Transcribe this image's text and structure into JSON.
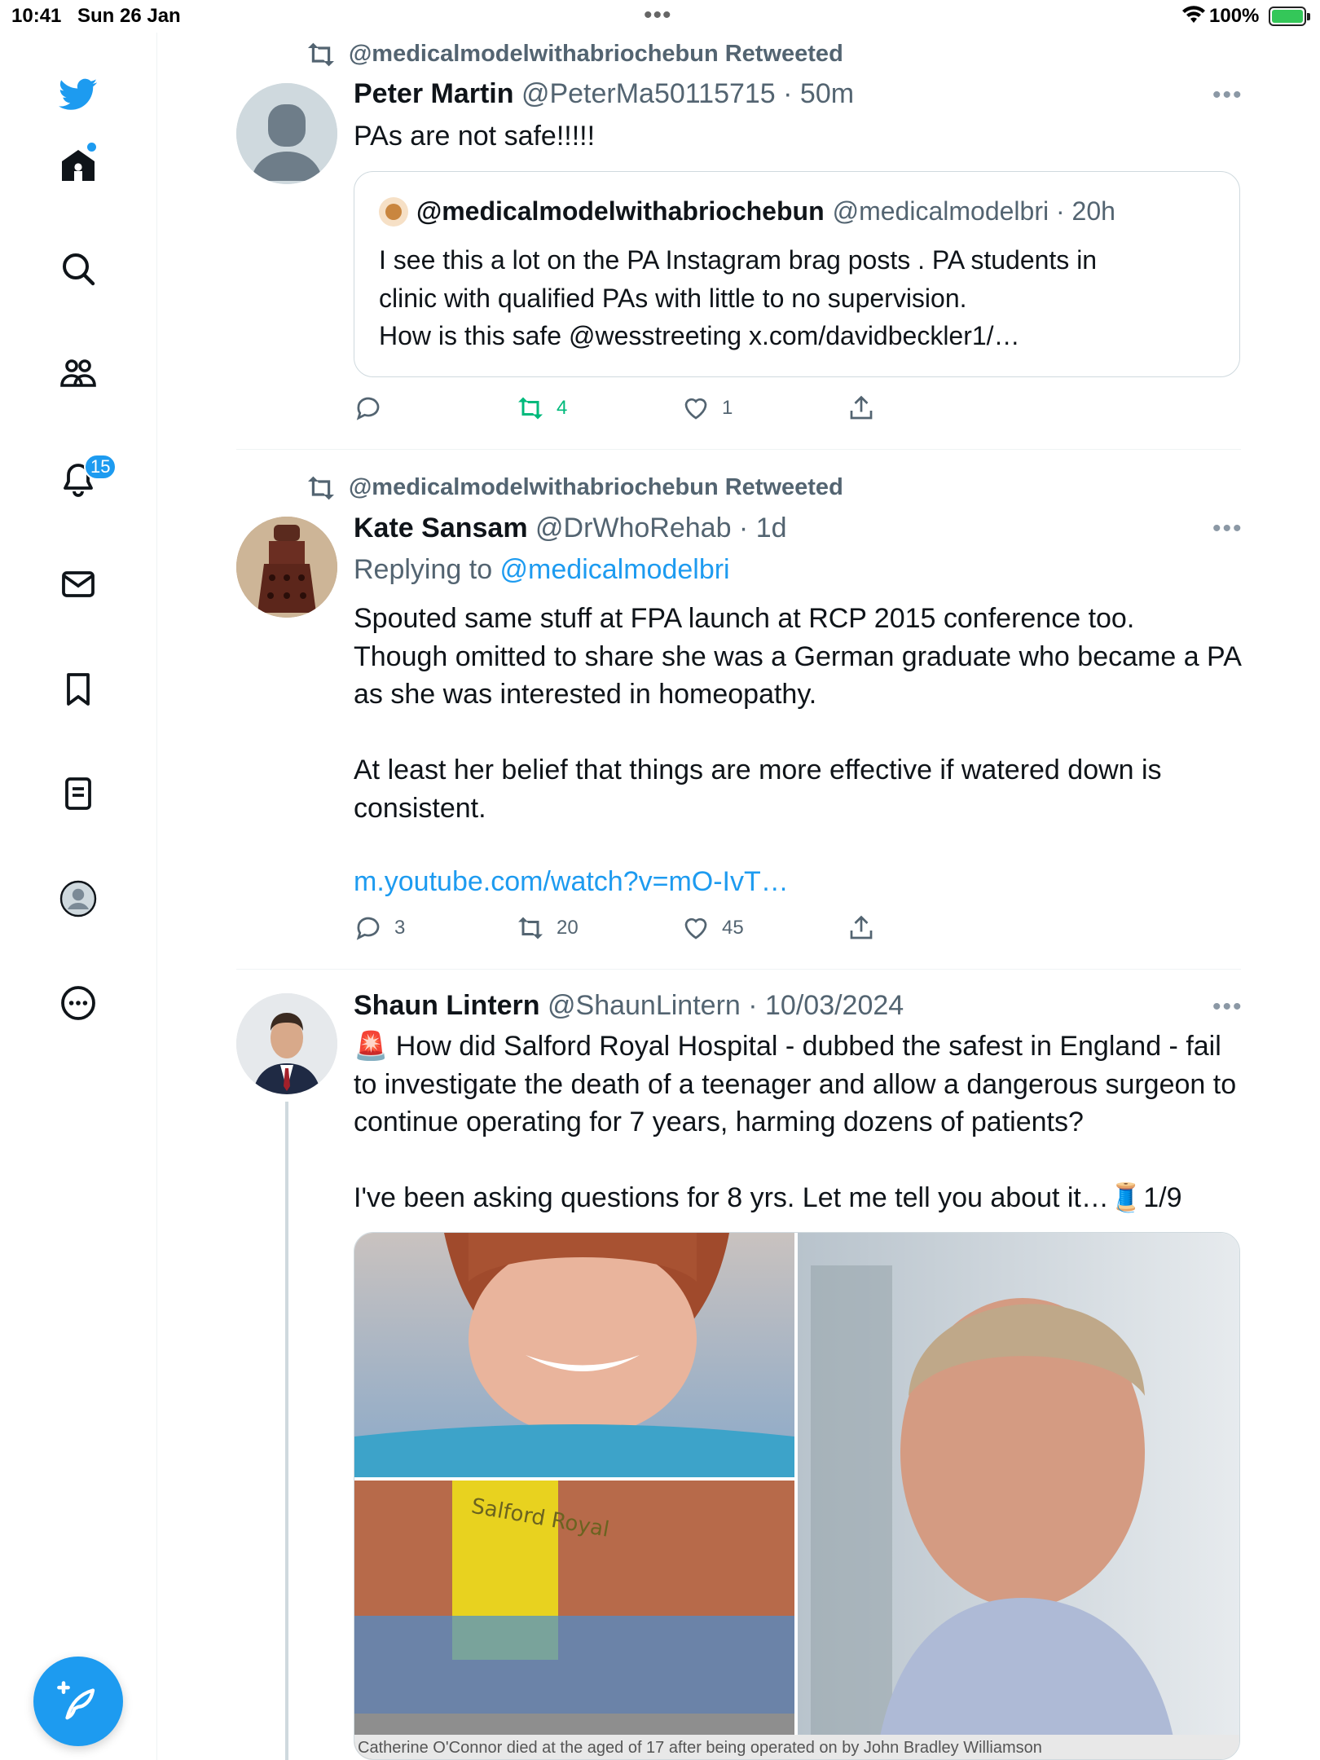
{
  "status_bar": {
    "time": "10:41",
    "date": "Sun 26 Jan",
    "battery": "100%"
  },
  "sidebar": {
    "items": [
      {
        "name": "twitter-logo-icon"
      },
      {
        "name": "home-icon"
      },
      {
        "name": "search-icon"
      },
      {
        "name": "communities-icon"
      },
      {
        "name": "notifications-icon"
      },
      {
        "name": "messages-icon"
      },
      {
        "name": "bookmarks-icon"
      },
      {
        "name": "lists-icon"
      },
      {
        "name": "profile-icon"
      },
      {
        "name": "more-icon"
      }
    ],
    "notifications_badge": "15"
  },
  "tweets": [
    {
      "retweeted_by": "@medicalmodelwithabriochebun Retweeted",
      "name": "Peter Martin",
      "meta": "@PeterMa50115715 · 50m",
      "text": "PAs are not safe!!!!!",
      "quote": {
        "name": "@medicalmodelwithabriochebun",
        "meta": "@medicalmodelbri · 20h",
        "text": "I see this a lot on the PA Instagram brag posts . PA students in\nclinic with qualified PAs with little to no supervision.\nHow is this safe @wesstreeting x.com/davidbeckler1/…"
      },
      "replies": "",
      "retweets": "4",
      "likes": "1"
    },
    {
      "retweeted_by": "@medicalmodelwithabriochebun Retweeted",
      "name": "Kate Sansam",
      "meta": "@DrWhoRehab · 1d",
      "replying_prefix": "Replying to ",
      "replying_to": "@medicalmodelbri",
      "text": "Spouted same stuff at FPA launch at RCP 2015 conference too.\nThough omitted to share she was a German graduate who became a PA\nas she was interested in homeopathy.\n\nAt least her belief that things are more effective if watered down is\nconsistent.",
      "link": "m.youtube.com/watch?v=mO-IvT…",
      "replies": "3",
      "retweets": "20",
      "likes": "45"
    },
    {
      "name": "Shaun Lintern",
      "meta": "@ShaunLintern · 10/03/2024",
      "text": "🚨 How did Salford Royal Hospital - dubbed the safest in England - fail\nto investigate the death of a teenager and allow a dangerous surgeon to\ncontinue operating for 7 years, harming dozens of patients?\n\nI've been asking questions for 8 yrs. Let me tell you about it…🧵1/9",
      "media_sign": "Salford Royal",
      "media_caption": "Catherine O'Connor died at the aged of 17 after being operated on by John Bradley Williamson"
    }
  ],
  "colors": {
    "accent": "#1d9bf0",
    "retweet_green": "#00ba7c",
    "muted": "#536471"
  }
}
